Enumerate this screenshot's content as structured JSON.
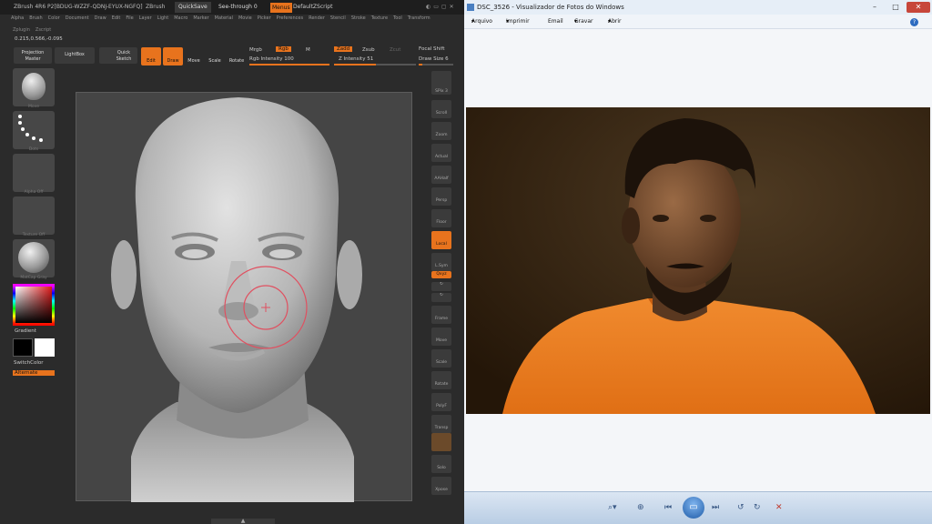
{
  "zbrush": {
    "title": "ZBrush 4R6 P2[BDUG-WZZF-QDNJ-EYUX-NGFQ]",
    "title_mode": "ZBrush",
    "quicksave": "QuickSave",
    "see_through": "See-through 0",
    "menus": "Menus",
    "default_script": "DefaultZScript",
    "menu_items": [
      "Alpha",
      "Brush",
      "Color",
      "Document",
      "Draw",
      "Edit",
      "File",
      "Layer",
      "Light",
      "Macro",
      "Marker",
      "Material",
      "Movie",
      "Picker",
      "Preferences",
      "Render",
      "Stencil",
      "Stroke",
      "Texture",
      "Tool",
      "Transform"
    ],
    "sub_menu": [
      "Zplugin",
      "Zscript"
    ],
    "coords": "0.215,0.566,-0.095",
    "shelf": {
      "projection_master": "Projection Master",
      "lightbox": "LightBox",
      "quick_sketch": "Quick Sketch",
      "edit": "Edit",
      "draw": "Draw",
      "move": "Move",
      "scale": "Scale",
      "rotate": "Rotate",
      "mrgb": "Mrgb",
      "rgb": "Rgb",
      "m": "M",
      "rgb_intensity": "Rgb Intensity 100",
      "zadd": "Zadd",
      "zsub": "Zsub",
      "zcut": "Zcut",
      "z_intensity": "Z Intensity 51",
      "focal_shift": "Focal Shift",
      "draw_size": "Draw Size 6"
    },
    "left": {
      "brush": "Move",
      "stroke": "Dots",
      "alpha": "Alpha Off",
      "texture": "Texture Off",
      "material": "MatCap Gray",
      "gradient": "Gradient",
      "switchcolor": "SwitchColor",
      "alternate": "Alternate"
    },
    "right_tools": [
      "SPix 3",
      "Scroll",
      "Zoom",
      "Actual",
      "AAHalf",
      "Persp",
      "Floor",
      "Local",
      "L.Sym",
      "Qxyz",
      "",
      "",
      "Frame",
      "Move",
      "Scale",
      "Rotate",
      "PolyF",
      "Transp",
      "",
      "Solo",
      "Xpose"
    ]
  },
  "photo_viewer": {
    "title": "DSC_3526 - Visualizador de Fotos do Windows",
    "menu": [
      "Arquivo",
      "Imprimir",
      "Email",
      "Gravar",
      "Abrir"
    ],
    "help": "?",
    "window_buttons": [
      "–",
      "□",
      "✕"
    ]
  },
  "colors": {
    "zbrush_orange": "#e8731d",
    "viewer_bg": "#f4f6f9"
  }
}
